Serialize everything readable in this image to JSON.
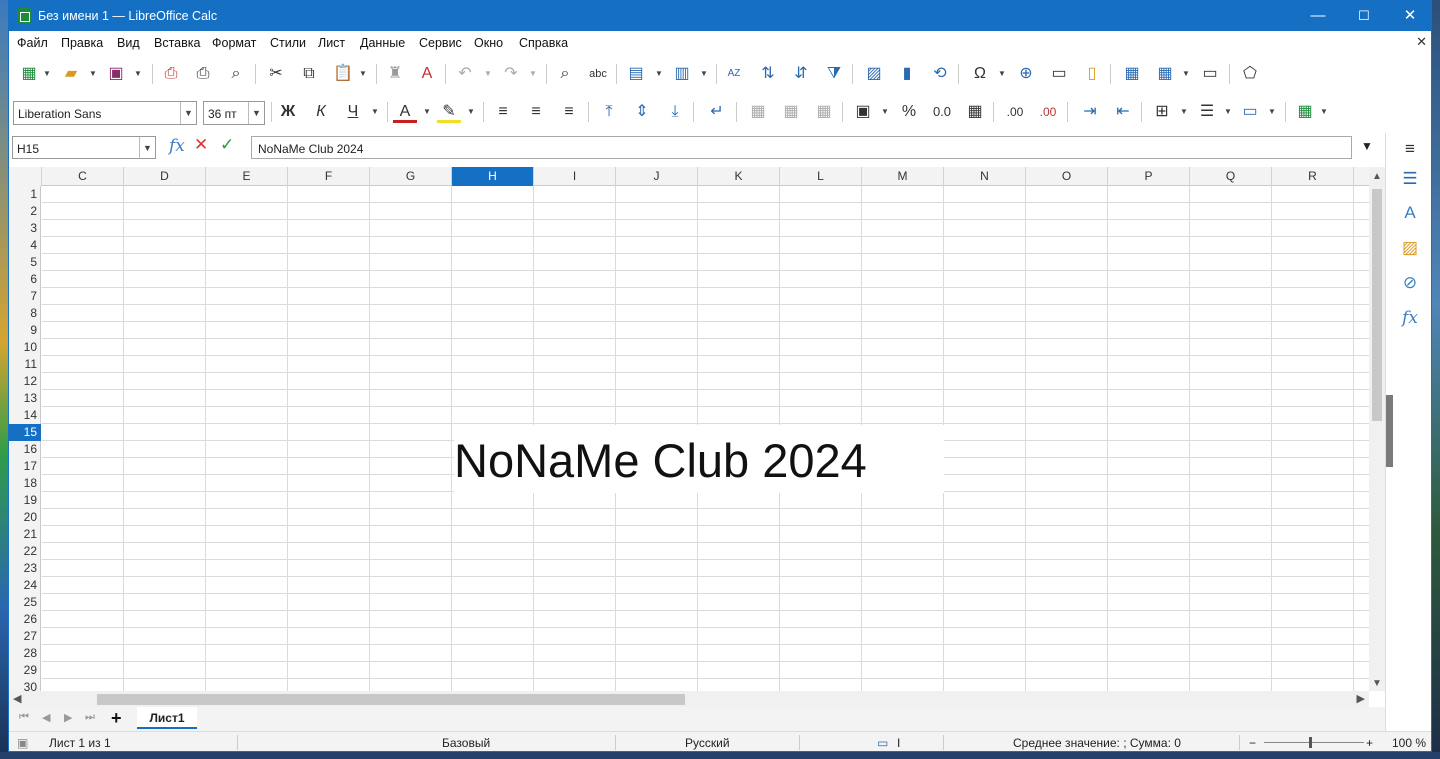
{
  "window": {
    "title": "Без имени 1 — LibreOffice Calc",
    "minimize": "—",
    "maximize": "☐",
    "close": "✕"
  },
  "menu": [
    "Файл",
    "Правка",
    "Вид",
    "Вставка",
    "Формат",
    "Стили",
    "Лист",
    "Данные",
    "Сервис",
    "Окно",
    "Справка"
  ],
  "formatting": {
    "font_name": "Liberation Sans",
    "font_size": "36 пт",
    "bold": "Ж",
    "italic": "К",
    "underline": "Ч"
  },
  "formula_bar": {
    "cell_ref": "H15",
    "content": "NoNaMe Club 2024"
  },
  "columns": [
    "C",
    "D",
    "E",
    "F",
    "G",
    "H",
    "I",
    "J",
    "K",
    "L",
    "M",
    "N",
    "O",
    "P",
    "Q",
    "R"
  ],
  "selected_column": "H",
  "rows": [
    "1",
    "2",
    "3",
    "4",
    "5",
    "6",
    "7",
    "8",
    "9",
    "10",
    "11",
    "12",
    "13",
    "14",
    "15",
    "16",
    "17",
    "18",
    "19",
    "20",
    "21",
    "22",
    "23",
    "24",
    "25",
    "26",
    "27",
    "28",
    "29",
    "30"
  ],
  "selected_row": "15",
  "cell_text": "NoNaMe Club 2024",
  "sheet_tab": "Лист1",
  "status": {
    "sheet": "Лист 1 из 1",
    "style": "Базовый",
    "language": "Русский",
    "summary": "Среднее значение: ; Сумма: 0",
    "zoom": "100 %"
  }
}
